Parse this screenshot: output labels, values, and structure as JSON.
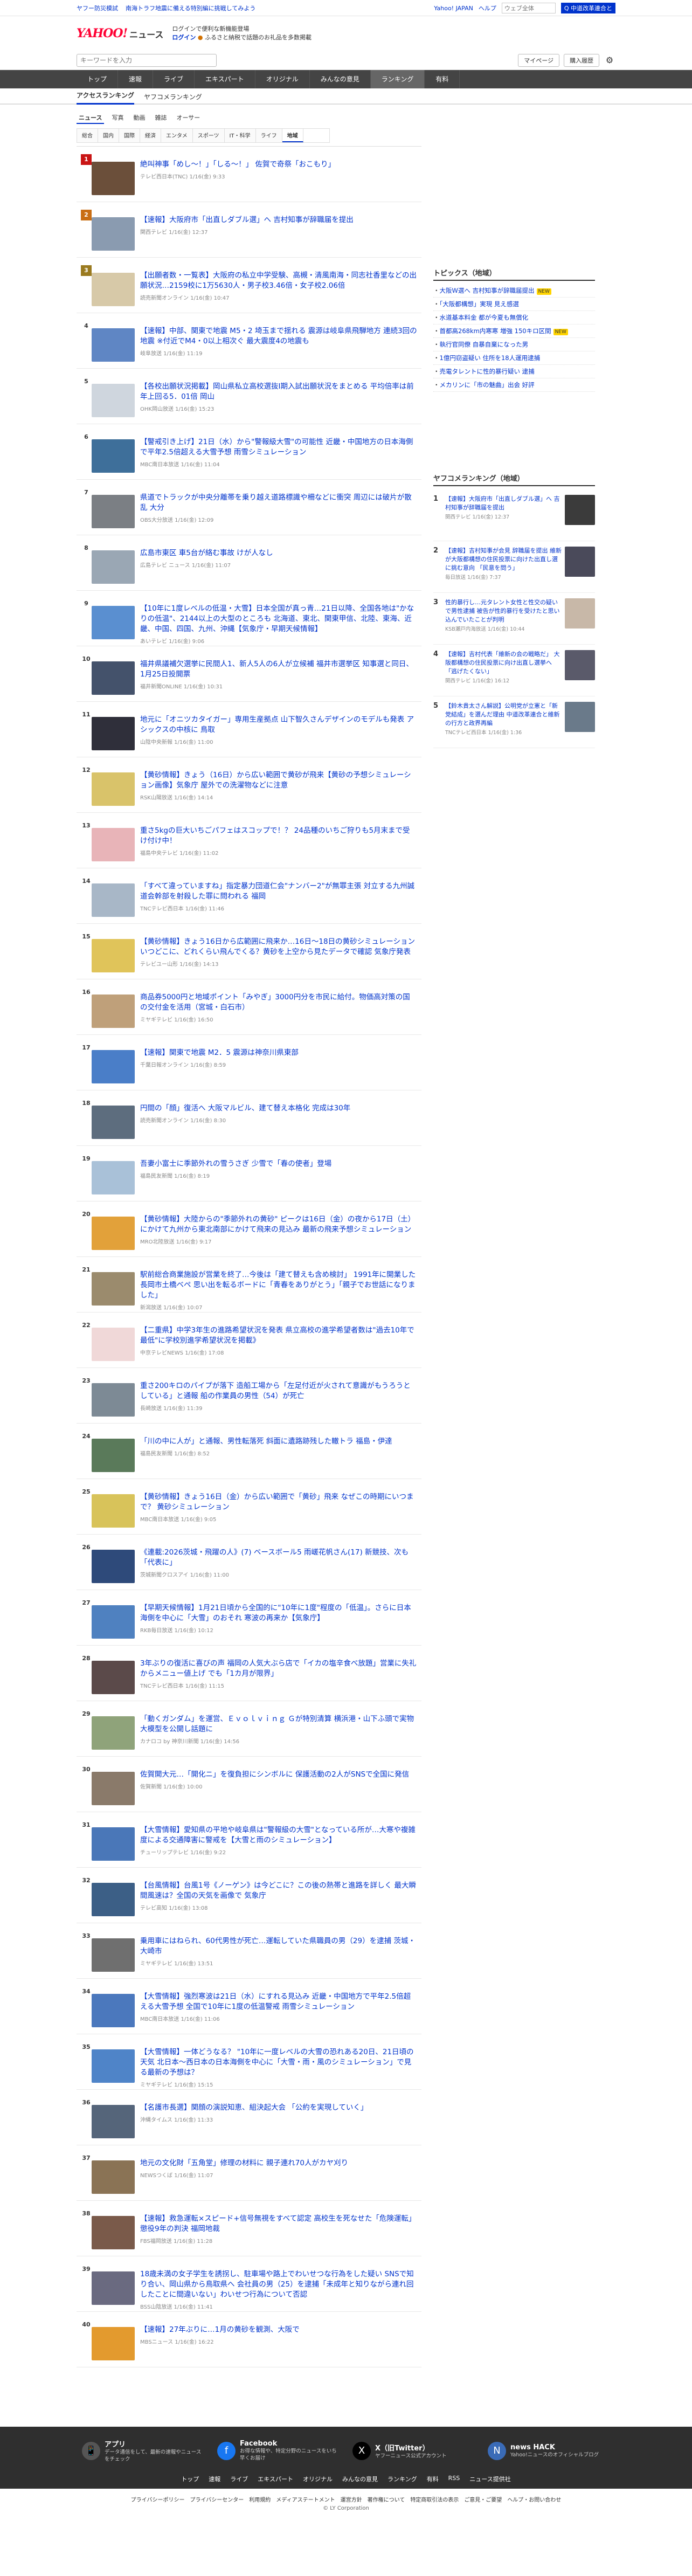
{
  "promo": {
    "links": [
      "ヤフー防災模試",
      "南海トラフ地震に備える特別編に挑戦してみよう"
    ],
    "right_links": [
      "Yahoo! JAPAN",
      "ヘルプ"
    ],
    "search_placeholder": "ウェブ全体",
    "search_button": "Q 中道改革連合と"
  },
  "header": {
    "logo": "YAHOO!",
    "logo_sub": "JAPAN",
    "service": "ニュース",
    "login_line1": "ログインで便利な新機能登場",
    "login_label": "ログイン",
    "login_line2": "ふるさと納税で話題のお礼品を多数掲載"
  },
  "search": {
    "placeholder": "キーワードを入力",
    "mypage": "マイページ",
    "plan": "購入履歴",
    "gear": "⚙"
  },
  "gnav": [
    "トップ",
    "速報",
    "ライブ",
    "エキスパート",
    "オリジナル",
    "みんなの意見",
    "ランキング",
    "有料"
  ],
  "subnav": [
    "アクセスランキング",
    "ヤフコメランキング"
  ],
  "cattabs": [
    "ニュース",
    "写真",
    "動画",
    "雑誌",
    "オーサー"
  ],
  "genres": [
    "総合",
    "国内",
    "国際",
    "経済",
    "エンタメ",
    "スポーツ",
    "IT・科学",
    "ライフ",
    "地域"
  ],
  "items": [
    {
      "rank": "1",
      "title": "絶叫神事「めし～！」「しる～！」 佐賀で奇祭「おこもり」",
      "meta": "テレビ西日本(TNC) 1/16(金) 9:33"
    },
    {
      "rank": "2",
      "title": "【速報】大阪府市「出直しダブル選」へ 吉村知事が辞職届を提出",
      "meta": "関西テレビ 1/16(金) 12:37"
    },
    {
      "rank": "3",
      "title": "【出願者数・一覧表】大阪府の私立中学受験、高槻・清風南海・同志社香里などの出願状況…2159校に1万5630人・男子校3.46倍・女子校2.06倍",
      "meta": "読売新聞オンライン 1/16(金) 10:47"
    },
    {
      "rank": "4",
      "title": "【速報】中部、関東で地震 M5・2 埼玉まで揺れる 震源は岐阜県飛騨地方 連続3回の地震 ※付近でM4・0以上相次ぐ 最大震度4の地震も",
      "meta": "岐阜放送 1/16(金) 11:19"
    },
    {
      "rank": "5",
      "title": "【各校出願状況掲載】岡山県私立高校選抜Ⅰ期入試出願状況をまとめる 平均倍率は前年上回る5．01倍 岡山",
      "meta": "OHK岡山放送 1/16(金) 15:23"
    },
    {
      "rank": "6",
      "title": "【警戒引き上げ】21日（水）から\"警報級大雪\"の可能性 近畿・中国地方の日本海側で平年2.5倍超える大雪予想 雨雪シミュレーション",
      "meta": "MBC南日本放送 1/16(金) 11:04"
    },
    {
      "rank": "7",
      "title": "県道でトラックが中央分離帯を乗り越え道路標識や柵などに衝突 周辺には破片が散乱 大分",
      "meta": "OBS大分放送 1/16(金) 12:09"
    },
    {
      "rank": "8",
      "title": "広島市東区 車5台が絡む事故 けが人なし",
      "meta": "広島テレビ ニュース 1/16(金) 11:07"
    },
    {
      "rank": "9",
      "title": "【10年に1度レベルの低温・大雪】日本全国が真っ青…21日以降、全国各地は\"かなりの低温\"、2144以上の大型のところも 北海道、東北、関東甲信、北陸、東海、近畿、中国、四国、九州、沖縄【気象庁・早期天候情報】",
      "meta": "あいテレビ 1/16(金) 9:06"
    },
    {
      "rank": "10",
      "title": "福井県議補欠選挙に民間人1、新人5人の6人が立候補 福井市選挙区 知事選と同日、1月25日投開票",
      "meta": "福井新聞ONLINE 1/16(金) 10:31"
    },
    {
      "rank": "11",
      "title": "地元に「オニツカタイガー」専用生産拠点 山下智久さんデザインのモデルも発表 アシックスの中核に 鳥取",
      "meta": "山陰中央新報 1/16(金) 11:00"
    },
    {
      "rank": "12",
      "title": "【黄砂情報】きょう（16日）から広い範囲で黄砂が飛来【黄砂の予想シミュレーション画像】気象庁 屋外での洗濯物などに注意",
      "meta": "RSK山陽放送 1/16(金) 14:14"
    },
    {
      "rank": "13",
      "title": "重さ5kgの巨大いちごパフェはスコップで！？ 24品種のいちご狩りも5月末まで受け付け中！",
      "meta": "福島中央テレビ 1/16(金) 11:02"
    },
    {
      "rank": "14",
      "title": "「すべて違っていますね」指定暴力団道仁会\"ナンバー2\"が無罪主張 対立する九州誠道会幹部を射殺した罪に問われる 福岡",
      "meta": "TNCテレビ西日本 1/16(金) 11:46"
    },
    {
      "rank": "15",
      "title": "【黄砂情報】きょう16日から広範囲に飛来か…16日～18日の黄砂シミュレーション いつどこに、どれくらい飛んでくる？黄砂を上空から見たデータで確認 気象庁発表",
      "meta": "テレビユー山形 1/16(金) 14:13"
    },
    {
      "rank": "16",
      "title": "商品券5000円と地域ポイント「みやぎ」3000円分を市民に給付。物価高対策の国の交付金を活用（宮城・白石市）",
      "meta": "ミヤギテレビ 1/16(金) 16:50"
    },
    {
      "rank": "17",
      "title": "【速報】関東で地震 M2．5 震源は神奈川県東部",
      "meta": "千葉日報オンライン 1/16(金) 8:59"
    },
    {
      "rank": "18",
      "title": "円間の「顔」復活へ 大阪マルビル、建て替え本格化 完成は30年",
      "meta": "読売新聞オンライン 1/16(金) 8:30"
    },
    {
      "rank": "19",
      "title": "吾妻小富士に季節外れの雪うさぎ 少雪で「春の使者」登場",
      "meta": "福島民友新聞 1/16(金) 8:19"
    },
    {
      "rank": "20",
      "title": "【黄砂情報】大陸からの\"季節外れの黄砂\" ピークは16日（金）の夜から17日（土）にかけて九州から東北南部にかけて飛来の見込み 最新の飛来予想シミュレーション",
      "meta": "MRO北陸放送 1/16(金) 9:17"
    },
    {
      "rank": "21",
      "title": "駅前総合商業施設が営業を終了…今後は「建て替えも含め検討」 1991年に開業した長岡市土橋ベペ 思い出を転るボードに「青春をありがとう」「親子でお世話になりました」",
      "meta": "新潟放送 1/16(金) 10:07"
    },
    {
      "rank": "22",
      "title": "【二重県】中学3年生の進路希望状況を発表 県立高校の進学希望者数は\"過去10年で最低\"に学校別進学希望状況を掲載》",
      "meta": "中京テレビNEWS 1/16(金) 17:08"
    },
    {
      "rank": "23",
      "title": "重さ200キロのパイプが落下 造船工場から「左足付近が火されて意識がもうろうとしている」と通報 船の作業員の男性（54）が死亡",
      "meta": "長崎放送 1/16(金) 11:39"
    },
    {
      "rank": "24",
      "title": "「川の中に人が」と通報、男性転落死 斜面に遺路跡残した轍トラ 福島・伊達",
      "meta": "福島民友新聞 1/16(金) 8:52"
    },
    {
      "rank": "25",
      "title": "【黄砂情報】きょう16日（金）から広い範囲で「黄砂」飛来 なぜこの時期にいつまで？ 黄砂シミュレーション",
      "meta": "MBC南日本放送 1/16(金) 9:05"
    },
    {
      "rank": "26",
      "title": "《連載:2026茨城・飛躍の人》(7) ベースボール5 雨嵯花帆さん(17) 新競技、次も「代表に」",
      "meta": "茨城新聞クロスアイ 1/16(金) 11:00"
    },
    {
      "rank": "27",
      "title": "【早期天候情報】1月21日頃から全国的に\"10年に1度\"程度の「低温」。さらに日本海側を中心に「大雪」のおそれ 寒波の再来か【気象庁】",
      "meta": "RKB毎日放送 1/16(金) 10:12"
    },
    {
      "rank": "28",
      "title": "3年ぶりの復活に喜びの声 福岡の人気大ぶら店で「イカの塩辛食べ放題」営業に失礼からメニュー値上げ でも「1カ月が限界」",
      "meta": "TNCテレビ西日本 1/16(金) 11:15"
    },
    {
      "rank": "29",
      "title": "「動くガンダム」を運営、Ｅｖｏｌｖｉｎｇ Ｇが特別清算 横浜港・山下ふ頭で実物大模型を公開し話題に",
      "meta": "カナロコ by 神奈川新聞 1/16(金) 14:56"
    },
    {
      "rank": "30",
      "title": "佐賀開大元…「開化ニ」を復負担にシンボルに 保護活動の2人がSNSで全国に発信",
      "meta": "佐賀新聞 1/16(金) 10:00"
    },
    {
      "rank": "31",
      "title": "【大雪情報】愛知県の平地や岐阜県は\"警報級の大雪\"となっている所が…大寒や複雑度による交通障害に警戒を【大雪と雨のシミュレーション】",
      "meta": "チューリップテレビ 1/16(金) 9:22"
    },
    {
      "rank": "32",
      "title": "【台風情報】台風1号《ノーゲン》は今どこに？この後の熱帯と進路を詳しく 最大瞬間風速は？全国の天気を画像で 気象庁",
      "meta": "テレビ高知 1/16(金) 13:08"
    },
    {
      "rank": "33",
      "title": "乗用車にはねられ、60代男性が死亡…運転していた県職員の男（29）を逮捕 茨城・大崎市",
      "meta": "ミヤギテレビ 1/16(金) 13:51"
    },
    {
      "rank": "34",
      "title": "【大雪情報】強烈寒波は21日（水）にすれる見込み 近畿・中国地方で平年2.5倍超える大雪予想 全国で10年に1度の低温警戒 雨雪シミュレーション",
      "meta": "MBC南日本放送 1/16(金) 11:06"
    },
    {
      "rank": "35",
      "title": "【大雪情報】一体どうなる？ \"10年に一度レベルの大雪の恐れある20日、21日頃の天気 北日本～西日本の日本海側を中心に「大雪・雨・風のシミュレーション」で見る最新の予想は？",
      "meta": "ミヤギテレビ 1/16(金) 15:15"
    },
    {
      "rank": "36",
      "title": "【名護市長選】関顔の演説知恵、組決起大会 「公約を実現していく」",
      "meta": "沖縄タイムス 1/16(金) 11:33"
    },
    {
      "rank": "37",
      "title": "地元の文化財「五角堂」修理の材料に 親子連れ70人がカヤ刈り",
      "meta": "NEWSつくば 1/16(金) 11:07"
    },
    {
      "rank": "38",
      "title": "【速報】救急運転×スピード+信号無視をすべて認定 高校生を死なせた「危険運転」懲役9年の判決 福岡地裁",
      "meta": "FBS福岡放送 1/16(金) 11:28"
    },
    {
      "rank": "39",
      "title": "18歳未満の女子学生を誘拐し、駐車場や路上でわいせつな行為をした疑い SNSで知り合い、岡山県から鳥取県へ 会社員の男（25）を逮捕「未成年と知りながら連れ回したことに間違いない」わいせつ行為について否認",
      "meta": "BSS山陰放送 1/16(金) 11:41"
    },
    {
      "rank": "40",
      "title": "【速報】27年ぶりに…1月の黄砂を観測、大阪で",
      "meta": "MBSニュース 1/16(金) 16:22"
    }
  ],
  "topics": {
    "title": "トピックス（地域）",
    "items": [
      {
        "text": "大阪W選へ 吉村知事が辞職届提出",
        "new": "NEW"
      },
      {
        "text": "「大阪都構想」実現 見え感選",
        "new": ""
      },
      {
        "text": "水道基本料金 都が今夏も無償化",
        "new": ""
      },
      {
        "text": "首都高268km内寒寒 増強 150キロ区間",
        "new": "NEW"
      },
      {
        "text": "執行官同僚 自暴自棄になった男",
        "new": ""
      },
      {
        "text": "1億円窃盗疑い 住所を18人運用逮捕",
        "new": ""
      },
      {
        "text": "売電タレントに性的暴行疑い 逮捕",
        "new": ""
      },
      {
        "text": "メカリンに「市の魅曲」出会 好評",
        "new": ""
      }
    ]
  },
  "side_ranking": {
    "title": "ヤフコメランキング（地域）",
    "items": [
      {
        "num": "1",
        "title": "【速報】大阪府市「出直しダブル選」へ 吉村知事が辞職届を提出",
        "meta": "関西テレビ 1/16(金) 12:37"
      },
      {
        "num": "2",
        "title": "【速報】吉村知事が会見 辞職届を提出 維新が大阪都構想の住民投票に向けた出直し選に挑む意向 「民意を問う」",
        "meta": "毎日放送 1/16(金) 7:37"
      },
      {
        "num": "3",
        "title": "性的暴行し…元タレント女性と性交の疑いで男性逮捕 被告が性的暴行を受けたと思い込んでいたことが判明",
        "meta": "KSB瀬戸内海放送 1/16(金) 10:44"
      },
      {
        "num": "4",
        "title": "【速報】吉村代表「維新の会の戦略だ」 大阪都構想の住民投票に向け出直し選挙へ 「逃げたくない」",
        "meta": "関西テレビ 1/16(金) 16:12"
      },
      {
        "num": "5",
        "title": "【鈴木貴太さん解説】公明党が立憲と「新党結成」を選んだ理由 中道改革連合と維新の行方と政界再編",
        "meta": "TNCテレビ西日本 1/16(金) 1:36"
      }
    ]
  },
  "footer": {
    "apps": [
      {
        "name": "アプリ",
        "desc": "データ通信をして、最新の速報やニュースをチェック",
        "icon": "smartphone-icon",
        "glyph": "📱",
        "color": "#555555"
      },
      {
        "name": "Facebook",
        "desc": "お得な情報や、特定分野のニュースをいち早くお届け",
        "icon": "facebook-icon",
        "glyph": "f",
        "color": "#1877f2"
      },
      {
        "name": "X（旧Twitter）",
        "desc": "ヤフーニュース公式アカウント",
        "icon": "x-icon",
        "glyph": "X",
        "color": "#000000"
      },
      {
        "name": "news HACK",
        "desc": "Yahoo!ニュースのオフィシャルブログ",
        "icon": "newshack-icon",
        "glyph": "N",
        "color": "#3a6bb7"
      }
    ],
    "nav": [
      "トップ",
      "速報",
      "ライブ",
      "エキスパート",
      "オリジナル",
      "みんなの意見",
      "ランキング",
      "有料",
      "RSS",
      "ニュース提供社"
    ],
    "legal": [
      "プライバシーポリシー",
      "プライバシーセンター",
      "利用規約",
      "メディアステートメント",
      "運営方針",
      "著作権について",
      "特定商取引法の表示",
      "ご意見・ご要望",
      "ヘルプ・お問い合わせ"
    ],
    "copyright": "© LY Corporation"
  }
}
